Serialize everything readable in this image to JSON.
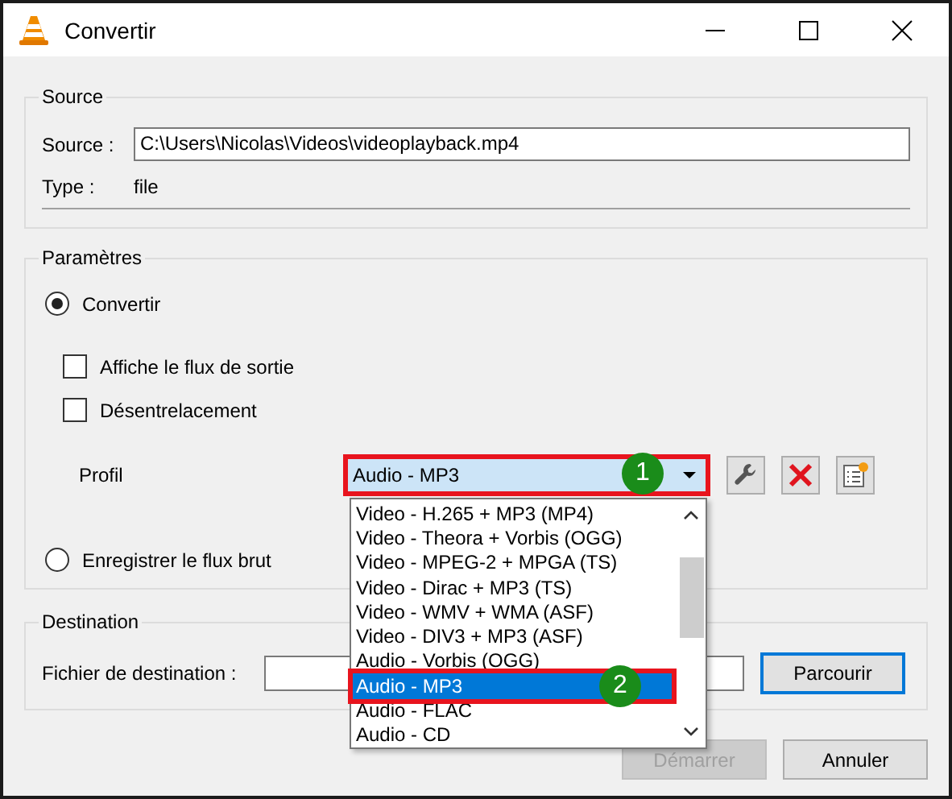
{
  "window": {
    "title": "Convertir"
  },
  "source": {
    "title": "Source",
    "label": "Source :",
    "value": "C:\\Users\\Nicolas\\Videos\\videoplayback.mp4",
    "type_label": "Type :",
    "type_value": "file"
  },
  "parametres": {
    "title": "Paramètres",
    "options": [
      {
        "kind": "radio",
        "label": "Convertir",
        "selected": true
      },
      {
        "kind": "checkbox",
        "label": "Affiche le flux de sortie",
        "checked": false
      },
      {
        "kind": "checkbox",
        "label": "Désentrelacement",
        "checked": false
      }
    ],
    "profile": {
      "label": "Profil",
      "value": "Audio - MP3",
      "items": [
        {
          "label": "Video - H.265 + MP3 (MP4)",
          "selected": false
        },
        {
          "label": "Video - Theora + Vorbis (OGG)",
          "selected": false
        },
        {
          "label": "Video - MPEG-2 + MPGA (TS)",
          "selected": false
        },
        {
          "label": "Video - Dirac + MP3 (TS)",
          "selected": false
        },
        {
          "label": "Video - WMV + WMA (ASF)",
          "selected": false
        },
        {
          "label": "Video - DIV3 + MP3 (ASF)",
          "selected": false
        },
        {
          "label": "Audio - Vorbis (OGG)",
          "selected": false
        },
        {
          "label": "Audio - MP3",
          "selected": true
        },
        {
          "label": "Audio - FLAC",
          "selected": false
        },
        {
          "label": "Audio - CD",
          "selected": false
        }
      ]
    },
    "raw": {
      "label": "Enregistrer le flux brut",
      "selected": false
    }
  },
  "destination": {
    "title": "Destination",
    "label": "Fichier de destination :",
    "browse": "Parcourir"
  },
  "buttons": [
    {
      "label": "Démarrer",
      "disabled": true
    },
    {
      "label": "Annuler",
      "disabled": false
    }
  ],
  "annotations": [
    {
      "label": "1"
    },
    {
      "label": "2"
    }
  ]
}
